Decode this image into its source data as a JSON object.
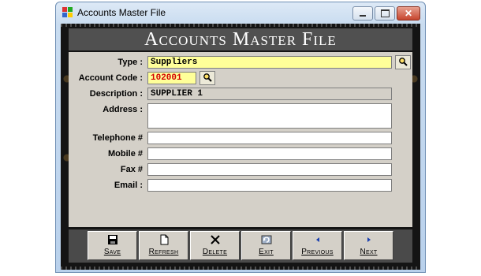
{
  "window": {
    "title": "Accounts Master File"
  },
  "header": {
    "title": "Accounts Master File"
  },
  "form": {
    "type": {
      "label": "Type :",
      "value": "Suppliers"
    },
    "account_code": {
      "label": "Account Code :",
      "value": "102001"
    },
    "description": {
      "label": "Description :",
      "value": "SUPPLIER 1"
    },
    "address": {
      "label": "Address :",
      "value": ""
    },
    "telephone": {
      "label": "Telephone # ",
      "value": ""
    },
    "mobile": {
      "label": "Mobile #",
      "value": ""
    },
    "fax": {
      "label": "Fax #",
      "value": ""
    },
    "email": {
      "label": "Email :",
      "value": ""
    }
  },
  "toolbar": {
    "save": "Save",
    "refresh": "Refresh",
    "delete": "Delete",
    "exit": "Exit",
    "previous": "Previous",
    "next": "Next"
  },
  "colors": {
    "highlight_field": "#ffff99",
    "code_text": "#d40000",
    "panel": "#d4d0c8",
    "header_bar": "#505050"
  },
  "icons": [
    "app-icon",
    "minimize-icon",
    "maximize-icon",
    "close-icon",
    "search-icon",
    "save-icon",
    "refresh-icon",
    "delete-icon",
    "exit-icon",
    "previous-icon",
    "next-icon"
  ]
}
